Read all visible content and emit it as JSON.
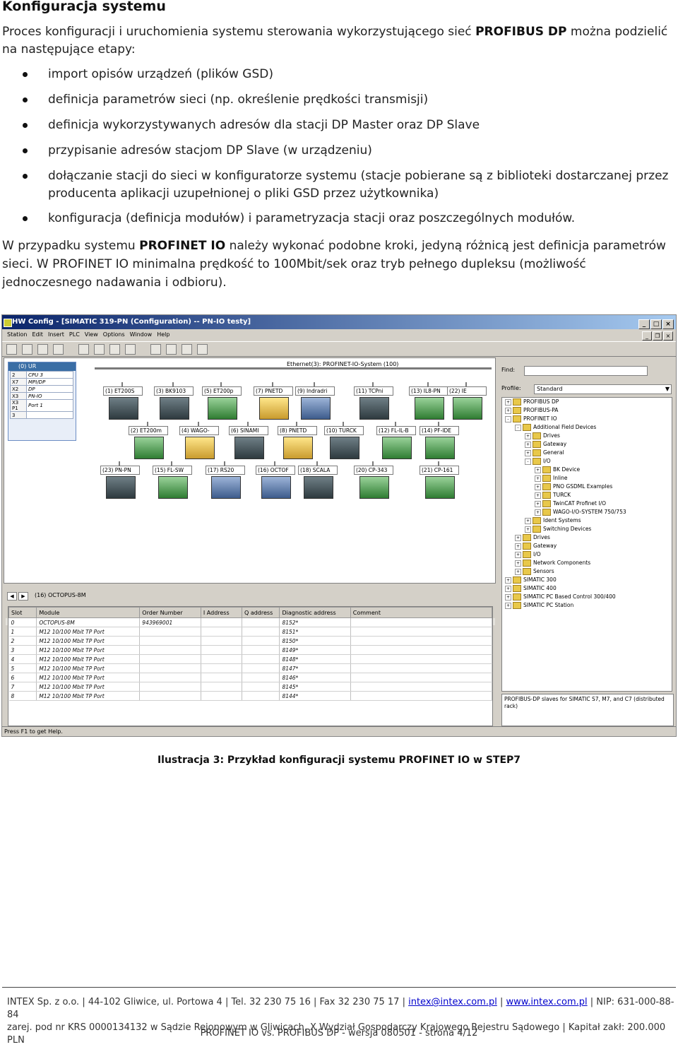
{
  "heading": "Konfiguracja systemu",
  "intro": {
    "before": "Proces konfiguracji i uruchomienia systemu sterowania wykorzystującego sieć ",
    "bold": "PROFIBUS DP",
    "after": " można podzielić na następujące etapy:"
  },
  "steps": [
    "import opisów urządzeń (plików GSD)",
    "definicja parametrów sieci (np. określenie prędkości transmisji)",
    "definicja wykorzystywanych adresów dla stacji DP Master oraz DP Slave",
    "przypisanie adresów stacjom DP Slave (w urządzeniu)",
    "dołączanie stacji do sieci w konfiguratorze systemu (stacje pobierane są z biblioteki dostarczanej przez producenta aplikacji uzupełnionej o pliki GSD przez użytkownika)",
    "konfiguracja (definicja modułów) i parametryzacja stacji oraz poszczególnych modułów."
  ],
  "profinet": {
    "before": "W przypadku systemu ",
    "bold": "PROFINET IO",
    "after": " należy wykonać podobne kroki, jedyną różnicą jest definicja parametrów sieci. W PROFINET IO minimalna prędkość to 100Mbit/sek oraz tryb pełnego dupleksu (możliwość jednoczesnego nadawania i odbioru)."
  },
  "screenshot": {
    "window_title": "HW Config - [SIMATIC 319-PN (Configuration) -- PN-IO testy]",
    "menu": [
      "Station",
      "Edit",
      "Insert",
      "PLC",
      "View",
      "Options",
      "Window",
      "Help"
    ],
    "station": {
      "header": "(0) UR",
      "rows": [
        {
          "slot": "2",
          "name": "CPU 3"
        },
        {
          "slot": "X7",
          "name": "MPI/DP"
        },
        {
          "slot": "X2",
          "name": "DP"
        },
        {
          "slot": "X3",
          "name": "PN-IO"
        },
        {
          "slot": "X3 P1",
          "name": "Port 1"
        },
        {
          "slot": "3",
          "name": ""
        }
      ]
    },
    "ethernet_label": "Ethernet(3): PROFINET-IO-System (100)",
    "devices": [
      {
        "label": "(1) ET200S",
        "color": "dark"
      },
      {
        "label": "(3) BK9103",
        "color": "dark"
      },
      {
        "label": "(5) ET200p",
        "color": "g"
      },
      {
        "label": "(7) PNETD",
        "color": "y"
      },
      {
        "label": "(9) Indradri",
        "color": "b"
      },
      {
        "label": "(11) TCPni",
        "color": "dark"
      },
      {
        "label": "(13) IL8-PN",
        "color": "g"
      },
      {
        "label": "(22) IE",
        "color": "g"
      },
      {
        "label": "(2) ET200m",
        "color": "g"
      },
      {
        "label": "(4) WAGO-",
        "color": "y"
      },
      {
        "label": "(6) SINAMI",
        "color": "dark"
      },
      {
        "label": "(8) PNETD",
        "color": "y"
      },
      {
        "label": "(10) TURCK",
        "color": "dark"
      },
      {
        "label": "(12) FL-IL-B",
        "color": "g"
      },
      {
        "label": "(14) PF-IDE",
        "color": "g"
      },
      {
        "label": "(23) PN-PN",
        "color": "dark"
      },
      {
        "label": "(15) FL-SW",
        "color": "g"
      },
      {
        "label": "(17) RS20",
        "color": "b"
      },
      {
        "label": "(16) OCTOF",
        "color": "b"
      },
      {
        "label": "(18) SCALA",
        "color": "dark"
      },
      {
        "label": "(20) CP-343",
        "color": "g"
      },
      {
        "label": "(21) CP-161",
        "color": "g"
      }
    ],
    "bottom_device": "(16)   OCTOPUS-8M",
    "table_headers": [
      "Slot",
      "Module",
      "Order Number",
      "I Address",
      "Q address",
      "Diagnostic address",
      "Comment"
    ],
    "table_rows": [
      {
        "slot": "0",
        "module": "OCTOPUS-8M",
        "order": "943969001",
        "diag": "8152*"
      },
      {
        "slot": "1",
        "module": "M12 10/100 Mbit TP Port",
        "order": "",
        "diag": "8151*"
      },
      {
        "slot": "2",
        "module": "M12 10/100 Mbit TP Port",
        "order": "",
        "diag": "8150*"
      },
      {
        "slot": "3",
        "module": "M12 10/100 Mbit TP Port",
        "order": "",
        "diag": "8149*"
      },
      {
        "slot": "4",
        "module": "M12 10/100 Mbit TP Port",
        "order": "",
        "diag": "8148*"
      },
      {
        "slot": "5",
        "module": "M12 10/100 Mbit TP Port",
        "order": "",
        "diag": "8147*"
      },
      {
        "slot": "6",
        "module": "M12 10/100 Mbit TP Port",
        "order": "",
        "diag": "8146*"
      },
      {
        "slot": "7",
        "module": "M12 10/100 Mbit TP Port",
        "order": "",
        "diag": "8145*"
      },
      {
        "slot": "8",
        "module": "M12 10/100 Mbit TP Port",
        "order": "",
        "diag": "8144*"
      }
    ],
    "catalog": {
      "find_label": "Find:",
      "profile_label": "Profile:",
      "profile_value": "Standard",
      "tree": [
        {
          "indent": 0,
          "sign": "+",
          "text": "PROFIBUS DP"
        },
        {
          "indent": 0,
          "sign": "+",
          "text": "PROFIBUS-PA"
        },
        {
          "indent": 0,
          "sign": "-",
          "text": "PROFINET IO"
        },
        {
          "indent": 1,
          "sign": "-",
          "text": "Additional Field Devices"
        },
        {
          "indent": 2,
          "sign": "+",
          "text": "Drives"
        },
        {
          "indent": 2,
          "sign": "+",
          "text": "Gateway"
        },
        {
          "indent": 2,
          "sign": "+",
          "text": "General"
        },
        {
          "indent": 2,
          "sign": "-",
          "text": "I/O"
        },
        {
          "indent": 3,
          "sign": "+",
          "text": "BK Device"
        },
        {
          "indent": 3,
          "sign": "+",
          "text": "Inline"
        },
        {
          "indent": 3,
          "sign": "+",
          "text": "PNO GSDML Examples"
        },
        {
          "indent": 3,
          "sign": "+",
          "text": "TURCK"
        },
        {
          "indent": 3,
          "sign": "+",
          "text": "TwinCAT Profinet I/O"
        },
        {
          "indent": 3,
          "sign": "+",
          "text": "WAGO-I/O-SYSTEM 750/753"
        },
        {
          "indent": 2,
          "sign": "+",
          "text": "Ident Systems"
        },
        {
          "indent": 2,
          "sign": "+",
          "text": "Switching Devices"
        },
        {
          "indent": 1,
          "sign": "+",
          "text": "Drives"
        },
        {
          "indent": 1,
          "sign": "+",
          "text": "Gateway"
        },
        {
          "indent": 1,
          "sign": "+",
          "text": "I/O"
        },
        {
          "indent": 1,
          "sign": "+",
          "text": "Network Components"
        },
        {
          "indent": 1,
          "sign": "+",
          "text": "Sensors"
        },
        {
          "indent": 0,
          "sign": "+",
          "text": "SIMATIC 300"
        },
        {
          "indent": 0,
          "sign": "+",
          "text": "SIMATIC 400"
        },
        {
          "indent": 0,
          "sign": "+",
          "text": "SIMATIC PC Based Control 300/400"
        },
        {
          "indent": 0,
          "sign": "+",
          "text": "SIMATIC PC Station"
        }
      ],
      "description": "PROFIBUS-DP slaves for SIMATIC S7, M7, and C7 (distributed rack)"
    },
    "status": "Press F1 to get Help."
  },
  "caption": "Ilustracja 3: Przykład konfiguracji systemu PROFINET IO w STEP7",
  "footer": {
    "line1_text": "INTEX Sp. z o.o. | 44-102 Gliwice, ul. Portowa 4 | Tel. 32 230 75 16 | Fax 32 230 75 17 | ",
    "email": "intex@intex.com.pl",
    "sep": " | ",
    "web": "www.intex.com.pl",
    "nip": " | NIP: 631-000-88-84",
    "line2": "zarej. pod nr KRS 0000134132 w Sądzie Rejonowym w Gliwicach, X Wydział Gospodarczy Krajowego Rejestru Sądowego | Kapitał zakł: 200.000 PLN",
    "page": "PROFINET IO vs. PROFIBUS DP - wersja 080501 - strona 4/12"
  }
}
